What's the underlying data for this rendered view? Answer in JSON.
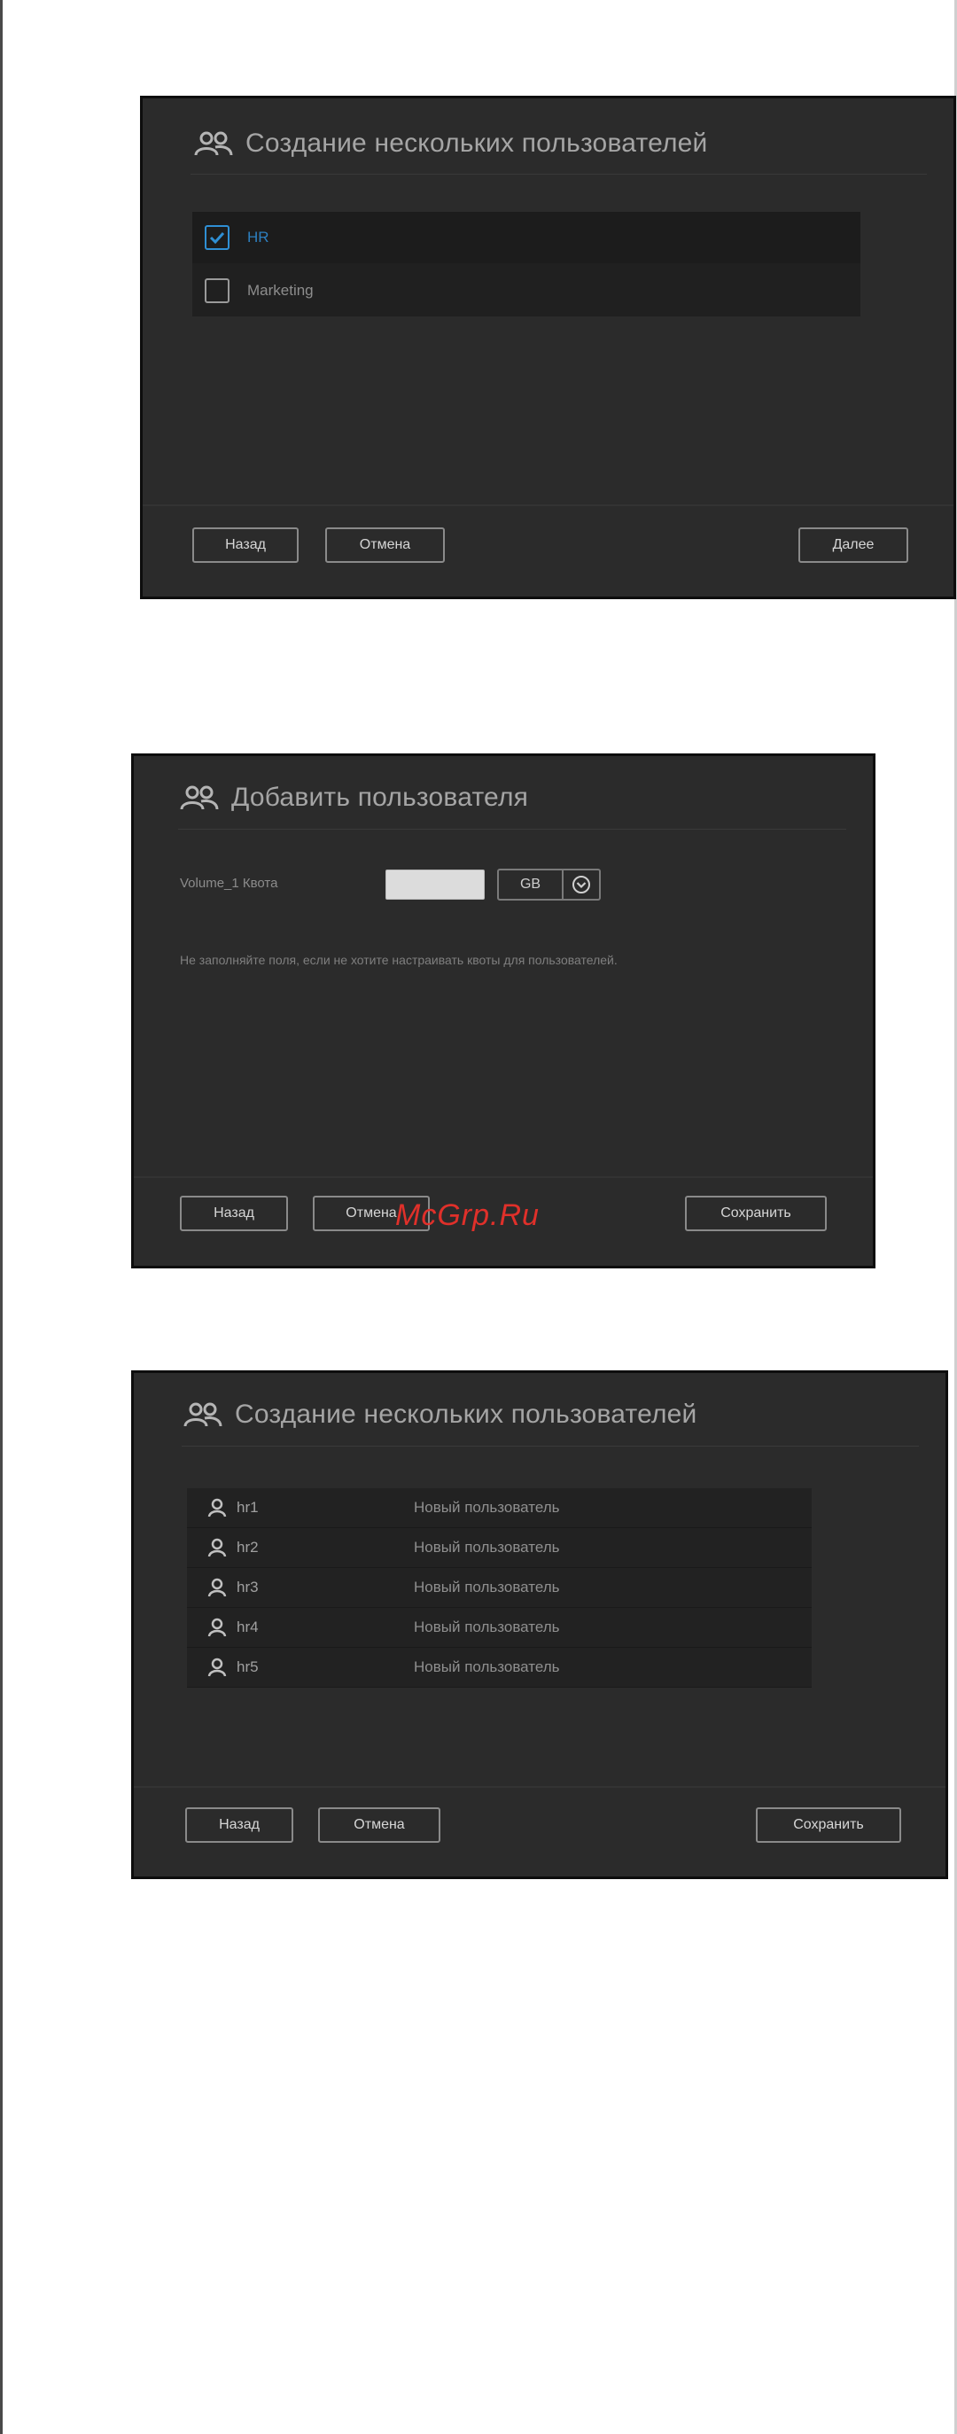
{
  "dialog_create_users_groups": {
    "title": "Создание нескольких пользователей",
    "groups": [
      {
        "label": "HR",
        "checked": true
      },
      {
        "label": "Marketing",
        "checked": false
      }
    ],
    "buttons": {
      "back": "Назад",
      "cancel": "Отмена",
      "next": "Далее"
    }
  },
  "dialog_add_user": {
    "title": "Добавить пользователя",
    "quota_label": "Volume_1 Квота",
    "quota_value": "",
    "unit": "GB",
    "hint": "Не заполняйте поля, если не хотите настраивать квоты для пользователей.",
    "buttons": {
      "back": "Назад",
      "cancel": "Отмена",
      "save": "Сохранить"
    }
  },
  "dialog_create_users_list": {
    "title": "Создание нескольких пользователей",
    "users": [
      {
        "name": "hr1",
        "desc": "Новый пользователь"
      },
      {
        "name": "hr2",
        "desc": "Новый пользователь"
      },
      {
        "name": "hr3",
        "desc": "Новый пользователь"
      },
      {
        "name": "hr4",
        "desc": "Новый пользователь"
      },
      {
        "name": "hr5",
        "desc": "Новый пользователь"
      }
    ],
    "buttons": {
      "back": "Назад",
      "cancel": "Отмена",
      "save": "Сохранить"
    }
  },
  "watermark": "McGrp.Ru",
  "colors": {
    "dialog_bg": "#2b2b2b",
    "accent": "#2f8fd4",
    "watermark": "#e0302a"
  }
}
